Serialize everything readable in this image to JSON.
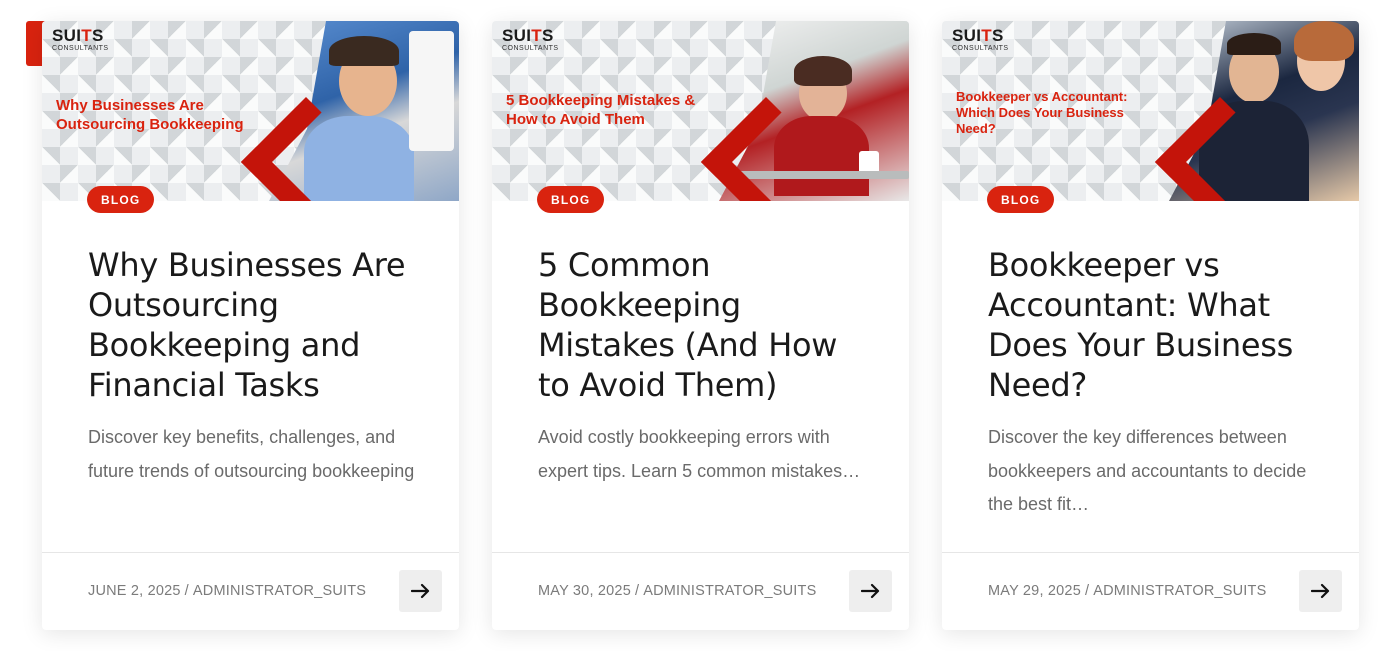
{
  "colors": {
    "accent": "#d9230f",
    "title": "#1a1a1a",
    "text": "#6a6a6a",
    "meta": "#7b7b7b"
  },
  "cards": [
    {
      "brand": {
        "prefix": "SUI",
        "highlight": "T",
        "suffix": "S",
        "sub": "CONSULTANTS"
      },
      "hero_text": "Why Businesses Are Outsourcing Bookkeeping",
      "badge": "BLOG",
      "title": "Why Businesses Are Outsourcing Bookkeeping and Financial Tasks",
      "excerpt": "Discover key benefits, challenges, and future trends of outsourcing bookkeeping",
      "date": "JUNE 2, 2025",
      "separator": "/",
      "author": "ADMINISTRATOR_SUITS",
      "arrow_icon": "arrow-right-icon"
    },
    {
      "brand": {
        "prefix": "SUI",
        "highlight": "T",
        "suffix": "S",
        "sub": "CONSULTANTS"
      },
      "hero_text": "5 Bookkeeping Mistakes & How to Avoid Them",
      "badge": "BLOG",
      "title": "5 Common Bookkeeping Mistakes (And How to Avoid Them)",
      "excerpt": "Avoid costly bookkeeping errors with expert tips. Learn 5 common mistakes…",
      "date": "MAY 30, 2025",
      "separator": "/",
      "author": "ADMINISTRATOR_SUITS",
      "arrow_icon": "arrow-right-icon"
    },
    {
      "brand": {
        "prefix": "SUI",
        "highlight": "T",
        "suffix": "S",
        "sub": "CONSULTANTS"
      },
      "hero_text": "Bookkeeper vs Accountant: Which Does Your Business Need?",
      "badge": "BLOG",
      "title": "Bookkeeper vs Accountant: What Does Your Business Need?",
      "excerpt": "Discover the key differences between bookkeepers and accountants to decide the best fit…",
      "date": "MAY 29, 2025",
      "separator": "/",
      "author": "ADMINISTRATOR_SUITS",
      "arrow_icon": "arrow-right-icon"
    }
  ]
}
